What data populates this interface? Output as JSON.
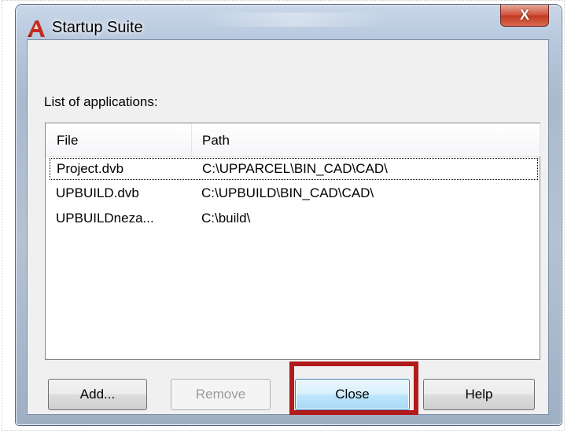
{
  "window": {
    "title": "Startup Suite",
    "close_glyph": "X",
    "icon": "autocad-a-icon",
    "accent_color": "#c0392b"
  },
  "list": {
    "label": "List of applications:",
    "columns": [
      "File",
      "Path"
    ],
    "rows": [
      {
        "file": "Project.dvb",
        "path": "C:\\UPPARCEL\\BIN_CAD\\CAD\\"
      },
      {
        "file": "UPBUILD.dvb",
        "path": "C:\\UPBUILD\\BIN_CAD\\CAD\\"
      },
      {
        "file": "UPBUILDneza...",
        "path": "C:\\build\\"
      }
    ]
  },
  "buttons": {
    "add": "Add...",
    "remove": "Remove",
    "close": "Close",
    "help": "Help"
  },
  "highlight_color": "#b11b1b"
}
